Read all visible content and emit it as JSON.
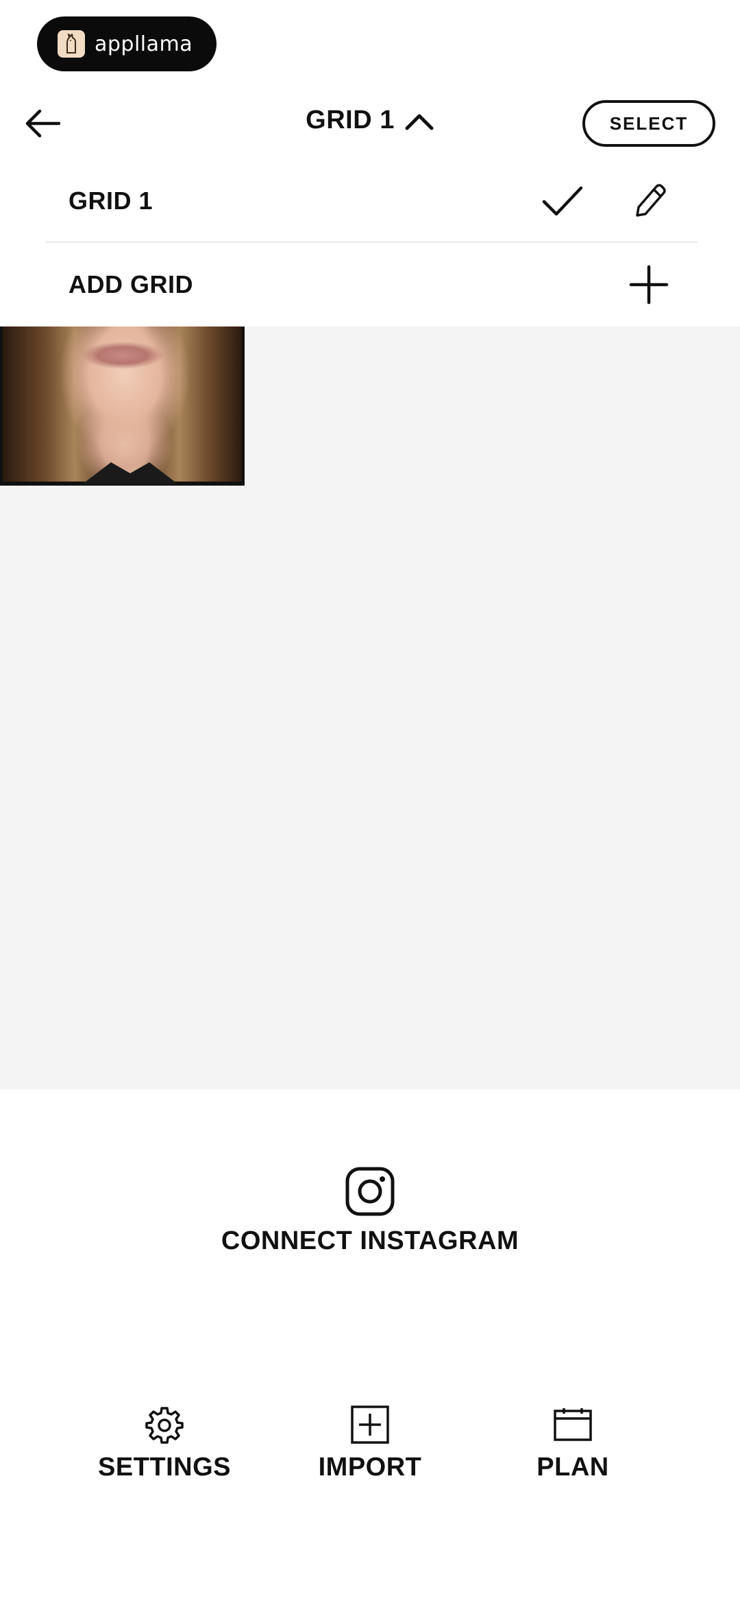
{
  "brand": {
    "name": "appllama"
  },
  "header": {
    "title": "GRID 1",
    "select_label": "SELECT"
  },
  "dropdown": {
    "items": [
      {
        "label": "GRID 1",
        "selected": true
      },
      {
        "label": "ADD GRID"
      }
    ]
  },
  "grid": {
    "tiles": [
      {
        "kind": "photo"
      }
    ]
  },
  "instagram": {
    "label": "CONNECT INSTAGRAM"
  },
  "nav": {
    "items": [
      {
        "label": "SETTINGS",
        "icon": "gear-icon"
      },
      {
        "label": "IMPORT",
        "icon": "plus-square-icon"
      },
      {
        "label": "PLAN",
        "icon": "calendar-icon"
      }
    ]
  },
  "colors": {
    "text": "#111111",
    "grid_background": "#f4f4f4",
    "pill_background": "#0b0b0b",
    "divider": "#e8e8e8"
  }
}
